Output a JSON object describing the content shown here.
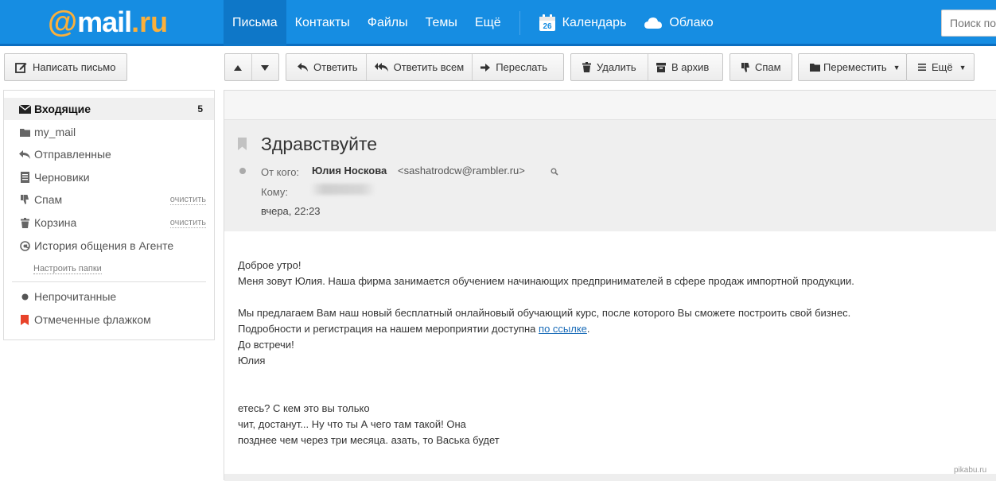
{
  "header": {
    "logo": {
      "at": "@",
      "brand": "mail",
      "dot": ".",
      "ru": "ru"
    },
    "nav": [
      {
        "label": "Письма",
        "active": true
      },
      {
        "label": "Контакты"
      },
      {
        "label": "Файлы"
      },
      {
        "label": "Темы"
      },
      {
        "label": "Ещё"
      }
    ],
    "calendar": {
      "label": "Календарь",
      "day": "26",
      "icon": "calendar-icon"
    },
    "cloud": {
      "label": "Облако",
      "icon": "cloud-icon"
    },
    "search_placeholder": "Поиск по"
  },
  "compose": {
    "label": "Написать письмо",
    "icon": "pencil-icon"
  },
  "toolbar": {
    "up_icon": "arrow-up-icon",
    "down_icon": "arrow-down-icon",
    "reply": "Ответить",
    "reply_all": "Ответить всем",
    "forward": "Переслать",
    "delete": "Удалить",
    "archive": "В архив",
    "spam": "Спам",
    "move": "Переместить",
    "more": "Ещё"
  },
  "sidebar": {
    "folders": [
      {
        "label": "Входящие",
        "count": "5",
        "icon": "envelope-icon",
        "active": true
      },
      {
        "label": "my_mail",
        "icon": "folder-icon"
      },
      {
        "label": "Отправленные",
        "icon": "reply-icon"
      },
      {
        "label": "Черновики",
        "icon": "draft-icon"
      },
      {
        "label": "Спам",
        "icon": "thumbs-down-icon",
        "action": "очистить"
      },
      {
        "label": "Корзина",
        "icon": "trash-icon",
        "action": "очистить"
      },
      {
        "label": "История общения в Агенте",
        "icon": "agent-icon"
      }
    ],
    "setup_link": "Настроить папки",
    "filters": [
      {
        "label": "Непрочитанные",
        "icon": "dot-icon"
      },
      {
        "label": "Отмеченные флажком",
        "icon": "flag-icon"
      }
    ]
  },
  "message": {
    "subject": "Здравствуйте",
    "from_label": "От кого:",
    "sender_name": "Юлия Носкова",
    "sender_email": "<sashatrodcw@rambler.ru>",
    "to_label": "Кому:",
    "date": "вчера, 22:23",
    "body": {
      "l1": "Доброе утро!",
      "l2": "Меня зовут Юлия. Наша фирма занимается обучением начинающих предпринимателей в сфере продаж импортной продукции.",
      "l3": "Мы предлагаем Вам наш новый бесплатный онлайновый обучающий курс, после которого Вы сможете построить свой бизнес.",
      "l4_prefix": "Подробности и регистрация на нашем мероприятии доступна ",
      "l4_link": "по ссылке",
      "l4_suffix": ".",
      "l5": "До встречи!",
      "l6": "Юлия",
      "l7": "етесь? С кем это вы только",
      "l8": "чит, достанут... Ну что ты А чего там такой! Она",
      "l9": "позднее чем через три месяца. азать, то Васька будет"
    }
  },
  "watermark": "pikabu.ru",
  "colors": {
    "topbar": "#168de2",
    "active_nav": "#0e77c8",
    "logo_accent": "#fbb03b",
    "spam_flag": "#e8432a",
    "link": "#1a6cb8"
  }
}
